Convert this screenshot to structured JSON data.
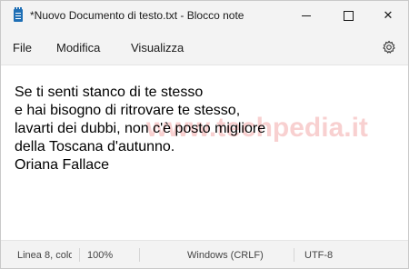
{
  "window": {
    "title": "*Nuovo Documento di testo.txt - Blocco note",
    "controls": {
      "minimize": "minimize-icon",
      "maximize": "maximize-icon",
      "close": "close-icon",
      "close_glyph": "✕"
    }
  },
  "menu": {
    "items": [
      "File",
      "Modifica",
      "Visualizza"
    ],
    "settings_icon": "gear-icon"
  },
  "editor": {
    "lines": [
      "Se ti senti stanco di te stesso",
      "e hai bisogno di ritrovare te stesso,",
      "lavarti dei dubbi, non c'è posto migliore",
      "della Toscana d'autunno.",
      "Oriana Fallace"
    ],
    "watermark": "www.techpedia.it"
  },
  "status": {
    "position": "Linea 8, colo",
    "zoom": "100%",
    "line_endings": "Windows (CRLF)",
    "encoding": "UTF-8"
  },
  "colors": {
    "chrome": "#f3f3f3",
    "text": "#1a1a1a",
    "icon_blue": "#1f6fb5",
    "watermark": "#eb7878"
  }
}
